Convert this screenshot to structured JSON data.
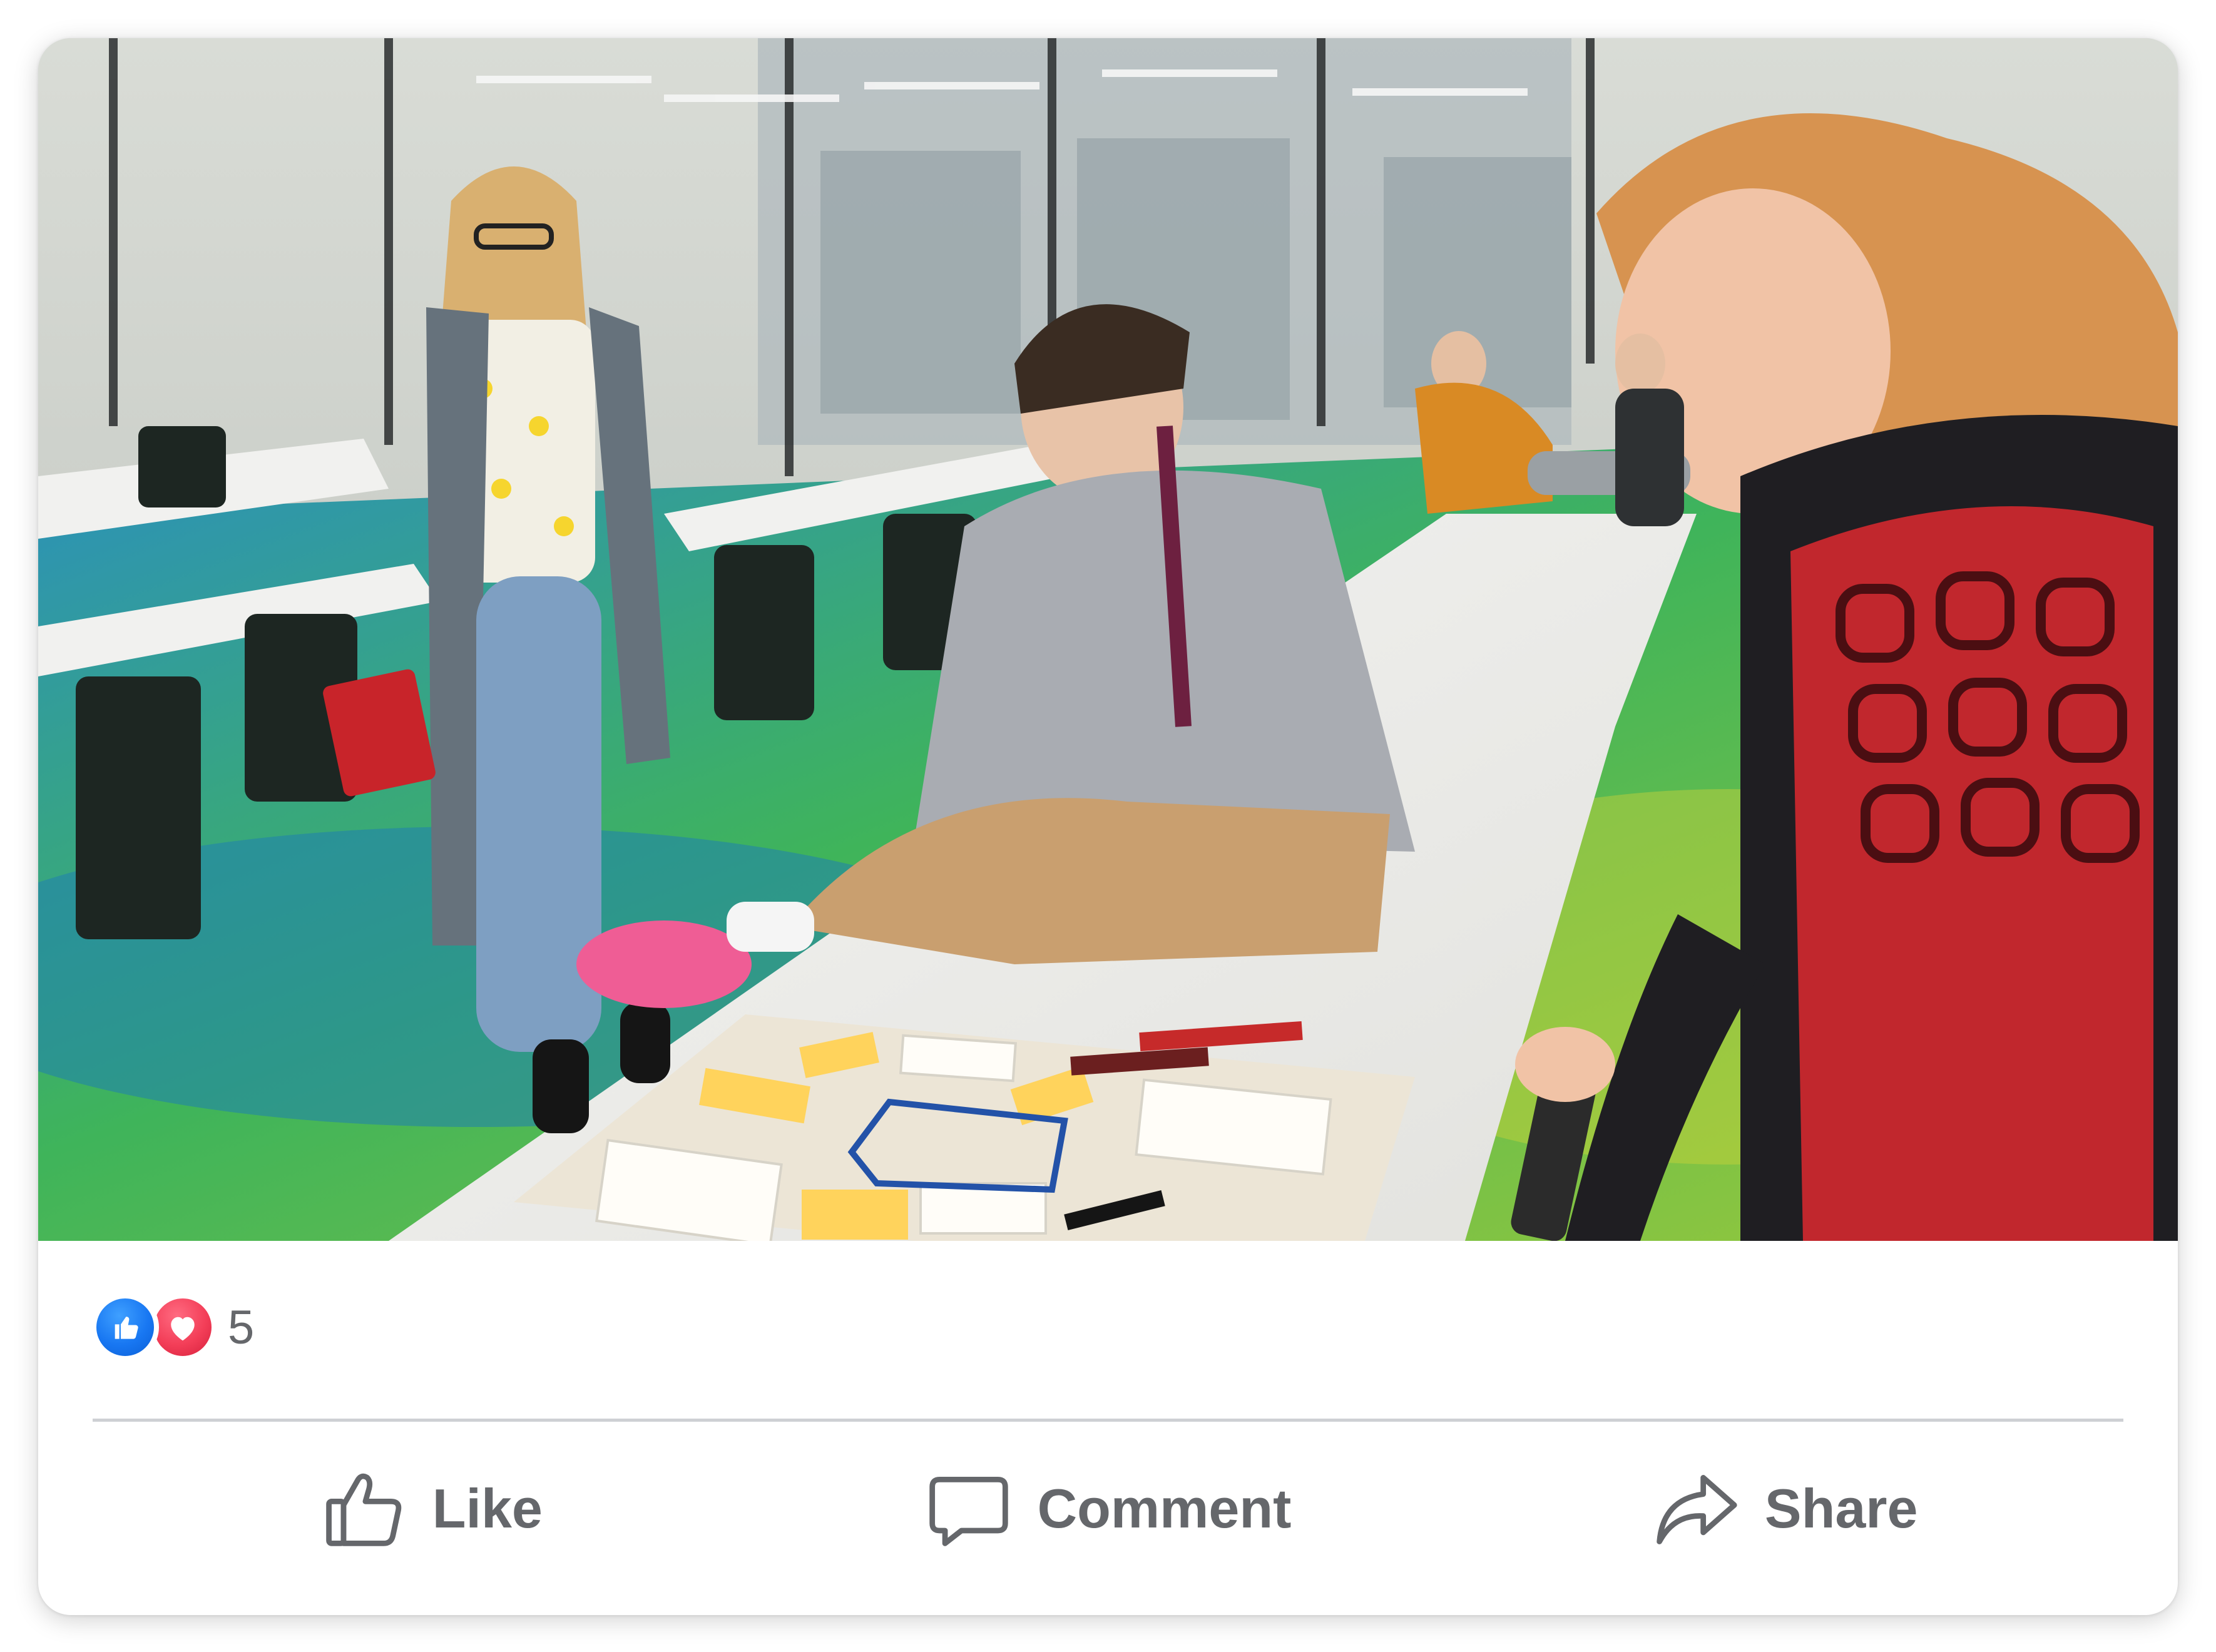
{
  "post": {
    "photo": {
      "icon": "photo-image"
    },
    "reactions": {
      "types": [
        "like-icon",
        "love-icon"
      ],
      "count": "5",
      "colors": {
        "like": "#1877f2",
        "love": "#f33e58"
      }
    },
    "actions": [
      {
        "label": "Like",
        "icon": "thumbs-up-icon"
      },
      {
        "label": "Comment",
        "icon": "comment-icon"
      },
      {
        "label": "Share",
        "icon": "share-icon"
      }
    ],
    "colors": {
      "action_text": "#65676b",
      "divider": "#ced0d4",
      "background": "#ffffff"
    }
  }
}
